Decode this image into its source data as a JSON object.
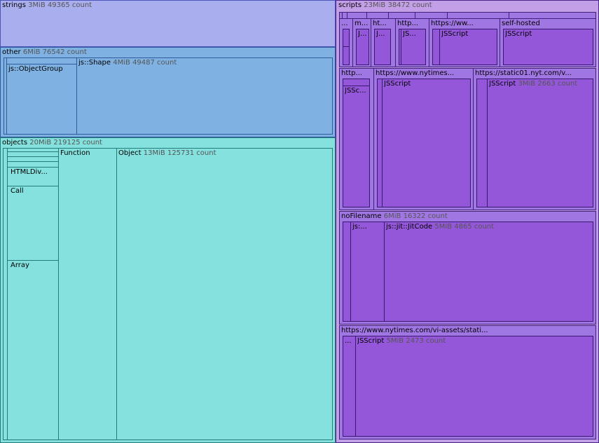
{
  "strings": {
    "name": "strings",
    "size": "3MiB",
    "count": "49365 count"
  },
  "other": {
    "name": "other",
    "size": "6MiB",
    "count": "76542 count",
    "object_group": "js::ObjectGroup",
    "shape": {
      "name": "js::Shape",
      "size": "4MiB",
      "count": "49487 count"
    }
  },
  "objects": {
    "name": "objects",
    "size": "20MiB",
    "count": "219125 count",
    "html_div": "HTMLDiv...",
    "call": "Call",
    "array": "Array",
    "function": "Function",
    "object": {
      "name": "Object",
      "size": "13MiB",
      "count": "125731 count"
    }
  },
  "scripts": {
    "name": "scripts",
    "size": "23MiB",
    "count": "38472 count",
    "top_row": [
      "...",
      "m...",
      "ht...",
      "http...",
      "https://ww...",
      "self-hosted"
    ],
    "top_row_inner": [
      "J...",
      "J...",
      "JS..."
    ],
    "jsscript": "JSScript",
    "second_row": {
      "http": "http...",
      "jsc": "JSSc...",
      "nytimes": "https://www.nytimes...",
      "static": "https://static01.nyt.com/v...",
      "static_jsscript": {
        "name": "JSScript",
        "size": "3MiB",
        "count": "2663 count"
      }
    },
    "no_filename": {
      "name": "noFilename",
      "size": "6MiB",
      "count": "16322 count",
      "js_dots": "js:...",
      "jit": {
        "name": "js::jit::JitCode",
        "size": "5MiB",
        "count": "4865 count"
      }
    },
    "vi_assets": {
      "name": "https://www.nytimes.com/vi-assets/stati...",
      "dots": "...",
      "jsscript": {
        "name": "JSScript",
        "size": "5MiB",
        "count": "2473 count"
      }
    }
  }
}
